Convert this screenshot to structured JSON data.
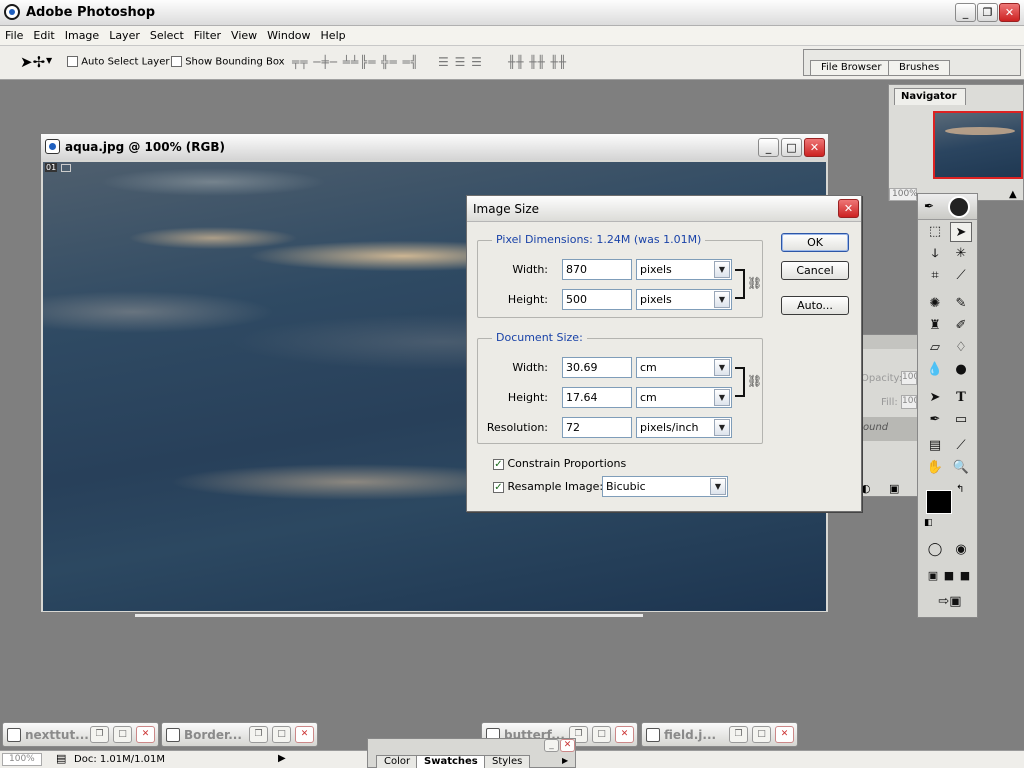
{
  "app": {
    "title": "Adobe Photoshop"
  },
  "menu": [
    "File",
    "Edit",
    "Image",
    "Layer",
    "Select",
    "Filter",
    "View",
    "Window",
    "Help"
  ],
  "options": {
    "auto_select": "Auto Select Layer",
    "show_bbox": "Show Bounding Box"
  },
  "palette_well": {
    "tabs": [
      "File Browser",
      "Brushes"
    ]
  },
  "document": {
    "title": "aqua.jpg @ 100% (RGB)",
    "corner": "01"
  },
  "dialog": {
    "title": "Image Size",
    "pixel_group": "Pixel Dimensions:  1.24M (was 1.01M)",
    "doc_group": "Document Size:",
    "labels": {
      "width": "Width:",
      "height": "Height:",
      "resolution": "Resolution:"
    },
    "pixel_width": "870",
    "pixel_height": "500",
    "pixel_unit": "pixels",
    "doc_width": "30.69",
    "doc_height": "17.64",
    "doc_unit": "cm",
    "resolution": "72",
    "res_unit": "pixels/inch",
    "constrain": "Constrain Proportions",
    "resample": "Resample Image:",
    "resample_method": "Bicubic",
    "buttons": {
      "ok": "OK",
      "cancel": "Cancel",
      "auto": "Auto..."
    }
  },
  "navigator": {
    "tab": "Navigator",
    "zoom": "100%"
  },
  "layers_partial": {
    "opacity": "Opacity:",
    "fill": "Fill:",
    "val": "100",
    "layer": "ound"
  },
  "minimized": [
    "nexttut...",
    "Border...",
    "butterf...",
    "field.j..."
  ],
  "status": {
    "zoom": "100%",
    "doc": "Doc: 1.01M/1.01M"
  },
  "color_palette": {
    "tabs": [
      "Color",
      "Swatches",
      "Styles"
    ]
  }
}
